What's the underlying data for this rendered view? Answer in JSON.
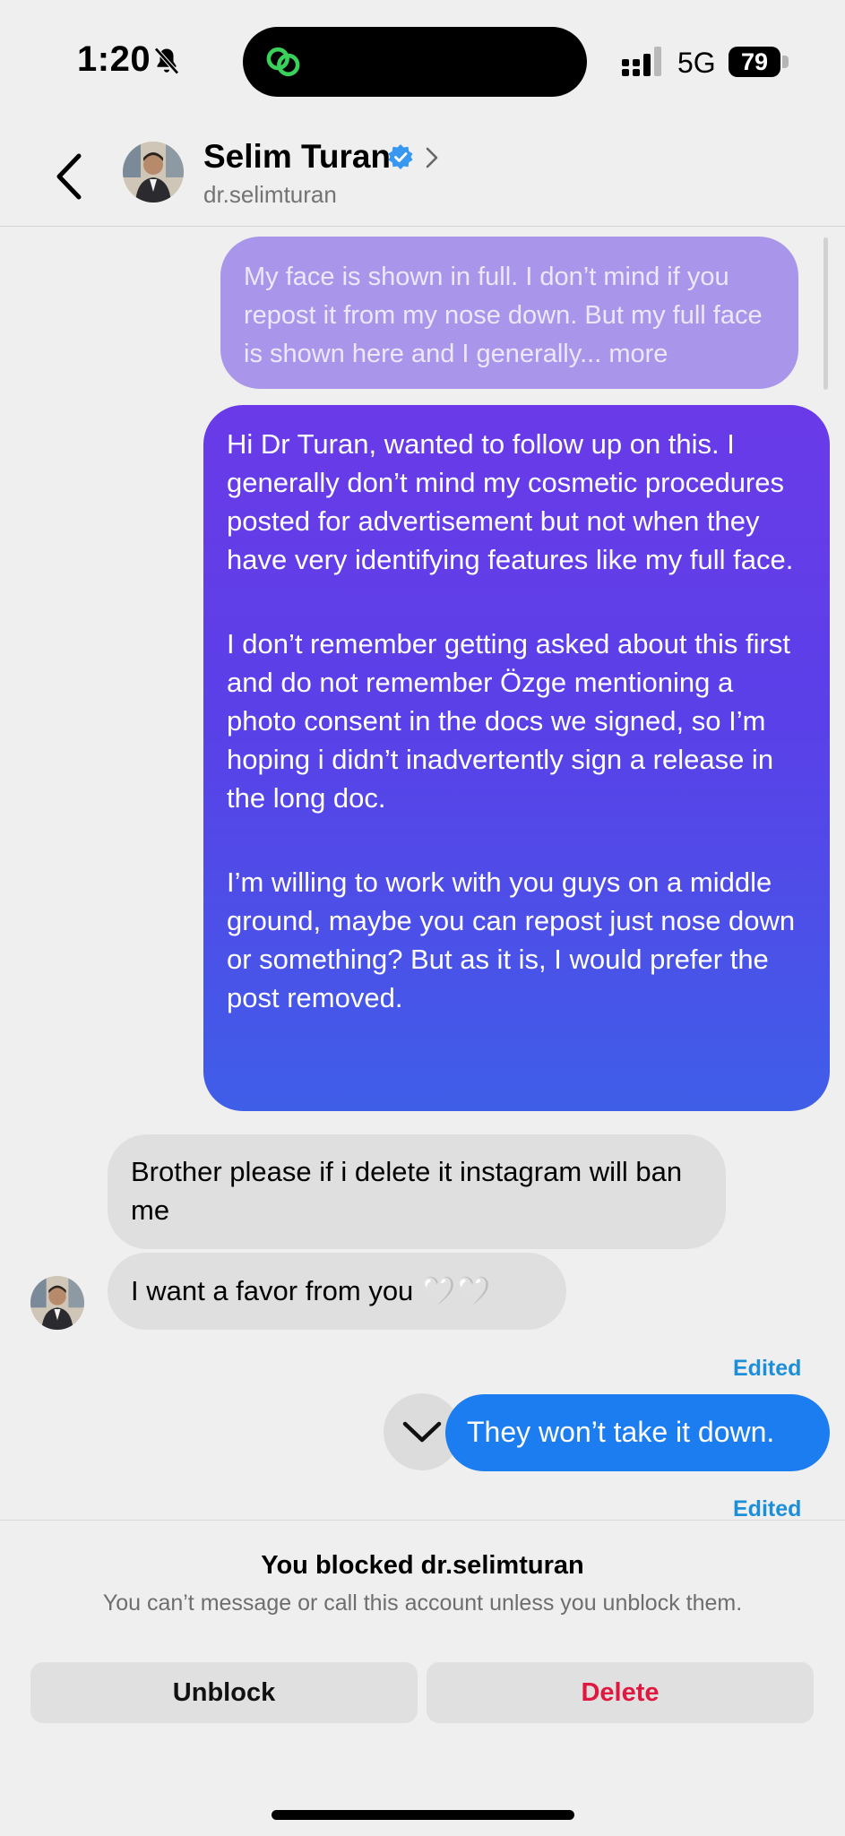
{
  "status_bar": {
    "time": "1:20",
    "network": "5G",
    "battery": "79"
  },
  "header": {
    "name": "Selim Turan",
    "handle": "dr.selimturan"
  },
  "messages": {
    "sent_1_preview": "My face is shown in full. I don’t mind if you repost it from my nose down. But my full face is shown here and I generally...",
    "sent_1_more": "more",
    "sent_2_paragraphs": [
      "Hi Dr Turan, wanted to follow up on this. I generally don’t mind my cosmetic procedures posted for advertisement but not when they have very identifying features like my full face.",
      "I don’t remember getting asked about this first and do not remember Özge mentioning a photo consent in the docs we signed, so I’m hoping i didn’t inadvertently sign a release in the long doc.",
      "I’m willing to work with you guys on a middle ground, maybe you can repost just nose down or something? But as it is, I would prefer the post removed."
    ],
    "received_1": "Brother please if i delete it instagram will ban me",
    "received_2": "I want a favor from you 🤍🤍",
    "edited_label_1": "Edited",
    "sent_3": "They won’t take it down.",
    "edited_label_2": "Edited"
  },
  "blocked_panel": {
    "title": "You blocked dr.selimturan",
    "subtitle": "You can’t message or call this account unless you unblock them.",
    "unblock_label": "Unblock",
    "delete_label": "Delete"
  },
  "colors": {
    "sent_bubble": "#1c7df0",
    "gradient_top": "#6a3ae8",
    "gradient_bottom": "#3f5ee8",
    "delete_red": "#e0183f",
    "edited_blue": "#1d8fd8"
  }
}
